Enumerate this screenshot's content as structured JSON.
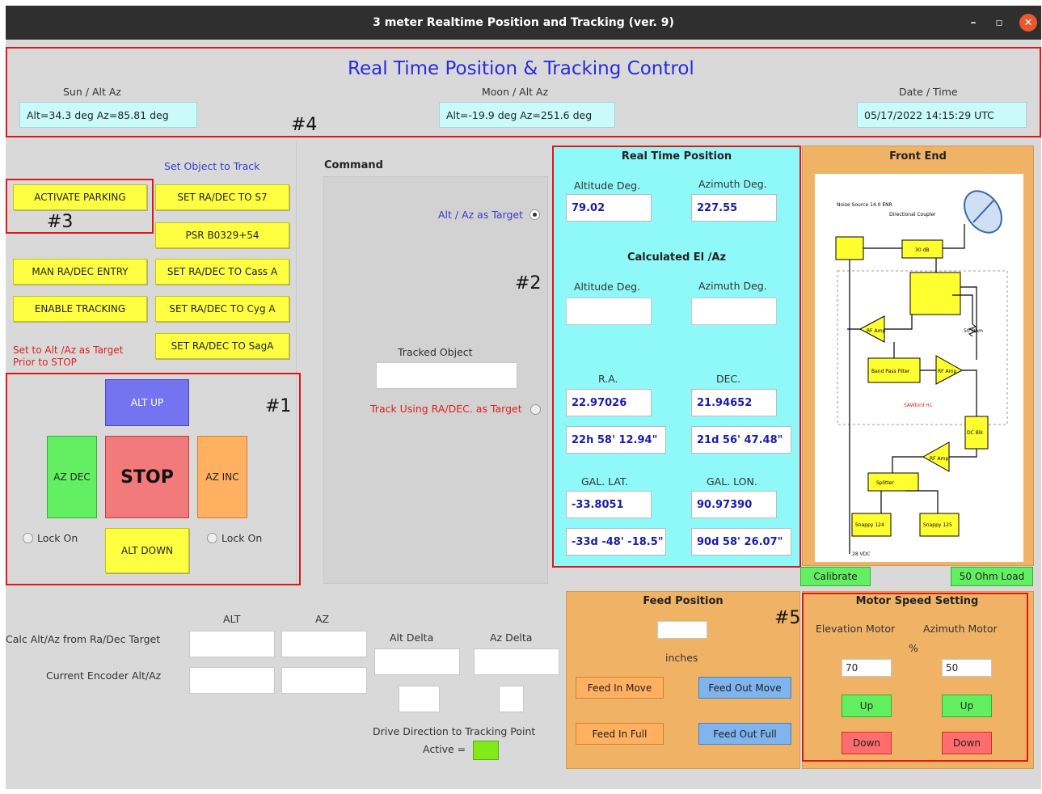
{
  "window": {
    "title": "3 meter Realtime Position and Tracking  (ver. 9)",
    "min_icon": "minimize-icon",
    "max_icon": "maximize-icon",
    "close_icon": "close-icon"
  },
  "header": {
    "title": "Real Time Position & Tracking Control",
    "sun_label": "Sun / Alt Az",
    "sun_value": "Alt=34.3 deg    Az=85.81 deg",
    "moon_label": "Moon / Alt Az",
    "moon_value": "Alt=-19.9 deg    Az=251.6 deg",
    "date_label": "Date / Time",
    "date_value": "05/17/2022  14:15:29 UTC"
  },
  "annotations": {
    "a1": "#1",
    "a2": "#2",
    "a3": "#3",
    "a4": "#4",
    "a5": "#5"
  },
  "left": {
    "set_object_label": "Set Object to Track",
    "activate_parking": "ACTIVATE PARKING",
    "set_s7": "SET RA/DEC TO S7",
    "psr": "PSR B0329+54",
    "man_entry": "MAN RA/DEC ENTRY",
    "set_cassa": "SET RA/DEC TO Cass A",
    "enable_tracking": "ENABLE TRACKING",
    "set_cyga": "SET RA/DEC TO Cyg A",
    "set_saga": "SET RA/DEC TO SagA",
    "warning": "Set to Alt /Az as Target Prior to STOP",
    "alt_up": "ALT UP",
    "az_dec": "AZ DEC",
    "stop": "STOP",
    "az_inc": "AZ INC",
    "alt_down": "ALT DOWN",
    "lock_on_left": "Lock On",
    "lock_on_right": "Lock On"
  },
  "command": {
    "title": "Command",
    "altaz_target": "Alt / Az as Target",
    "tracked_object": "Tracked Object",
    "track_radec": "Track Using RA/DEC. as Target"
  },
  "realtime": {
    "title": "Real Time Position",
    "alt_label": "Altitude Deg.",
    "az_label": "Azimuth Deg.",
    "alt_value": "79.02",
    "az_value": "227.55",
    "calc_title": "Calculated El /Az",
    "calc_alt_label": "Altitude Deg.",
    "calc_az_label": "Azimuth Deg.",
    "ra_label": "R.A.",
    "dec_label": "DEC.",
    "ra_value": "22.97026",
    "dec_value": "21.94652",
    "ra_hms": "22h 58' 12.94\"",
    "dec_dms": "21d 56' 47.48\"",
    "gal_lat_label": "GAL. LAT.",
    "gal_lon_label": "GAL. LON.",
    "gal_lat": "-33.8051",
    "gal_lon": "90.97390",
    "gal_lat_dms": "-33d -48' -18.5\"",
    "gal_lon_dms": "90d 58' 26.07\""
  },
  "frontend": {
    "title": "Front End",
    "calibrate": "Calibrate",
    "load": "50 Ohm Load",
    "d_noise": "Noise Source 14.0 ENR",
    "d_coupler": "Directional Coupler",
    "d_30db": "30 dB",
    "d_50ohm": "50 Ohm",
    "d_lna": "RF Amp",
    "d_bpf": "Band Pass Filter",
    "d_amp2": "RF Amp",
    "d_bias": "DC Blk",
    "d_amp3": "RF Amp",
    "d_splitter": "Splitter",
    "d_sdr1": "Snappy 124",
    "d_sdr2": "Snappy 125",
    "d_vdc": "28 VDC",
    "d_note": "SAWbird H1"
  },
  "bottom": {
    "alt_col": "ALT",
    "az_col": "AZ",
    "calc_row": "Calc Alt/Az from Ra/Dec Target",
    "enc_row": "Current Encoder Alt/Az",
    "alt_delta": "Alt Delta",
    "az_delta": "Az Delta",
    "drive_dir": "Drive Direction to Tracking Point",
    "active": "Active ="
  },
  "feed": {
    "title": "Feed Position",
    "inches": "inches",
    "feed_in_move": "Feed In Move",
    "feed_out_move": "Feed Out Move",
    "feed_in_full": "Feed In Full",
    "feed_out_full": "Feed Out Full"
  },
  "motor": {
    "title": "Motor Speed Setting",
    "elev": "Elevation Motor",
    "azim": "Azimuth Motor",
    "pct": "%",
    "elev_val": "70",
    "azim_val": "50",
    "up": "Up",
    "down": "Down"
  }
}
